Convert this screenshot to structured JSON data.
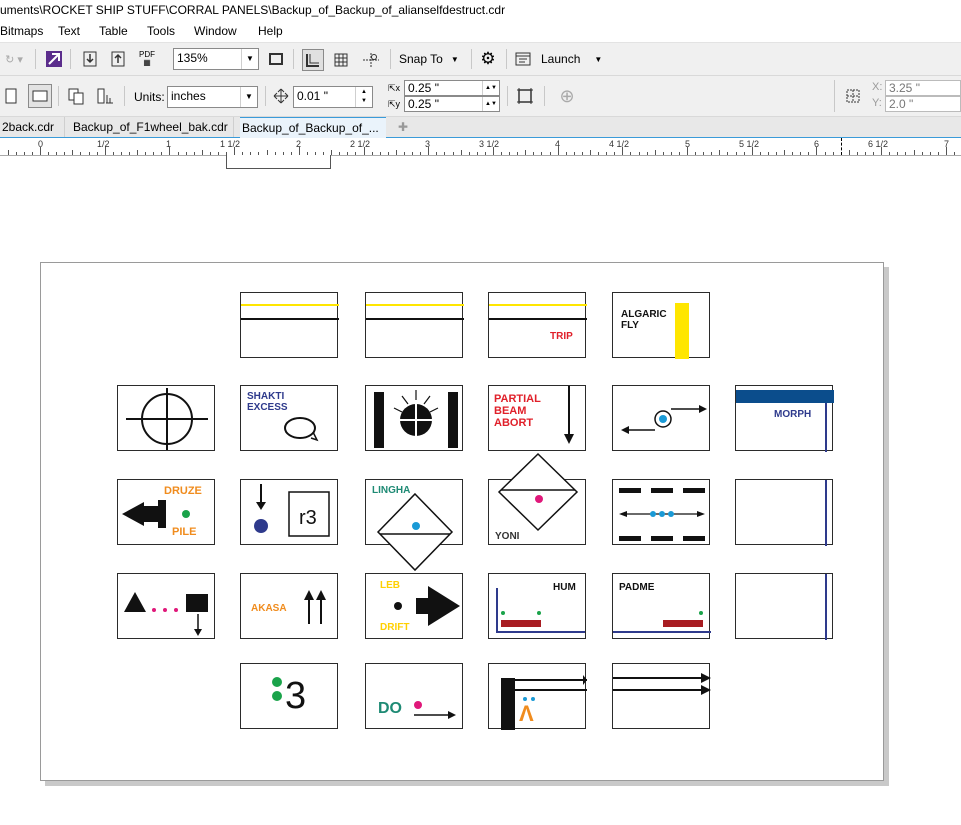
{
  "window": {
    "title": "uments\\ROCKET SHIP STUFF\\CORRAL PANELS\\Backup_of_Backup_of_alianselfdestruct.cdr"
  },
  "menu": {
    "items": [
      "Bitmaps",
      "Text",
      "Table",
      "Tools",
      "Window",
      "Help"
    ]
  },
  "toolbar": {
    "pdf_label": "PDF",
    "zoom": "135%",
    "snap_label": "Snap To",
    "launch_label": "Launch"
  },
  "property_bar": {
    "units_label": "Units:",
    "units_value": "inches",
    "nudge_value": "0.01 \"",
    "dup_x_value": "0.25 \"",
    "dup_y_value": "0.25 \"",
    "pos_x_label": "X:",
    "pos_x_value": "3.25 \"",
    "pos_y_label": "Y:",
    "pos_y_value": "2.0 \""
  },
  "tabs": [
    {
      "label": "2back.cdr",
      "active": false
    },
    {
      "label": "Backup_of_F1wheel_bak.cdr",
      "active": false
    },
    {
      "label": "Backup_of_Backup_of_...",
      "active": true
    }
  ],
  "ruler": {
    "labels": [
      "0",
      "1/2",
      "1",
      "1 1/2",
      "2",
      "2 1/2",
      "3",
      "3 1/2",
      "4",
      "4 1/2",
      "5",
      "5 1/2",
      "6",
      "6 1/2",
      "7"
    ]
  },
  "panels": {
    "trip": "TRIP",
    "algaric": "ALGARIC\nFLY",
    "shakti": "SHAKTI\nEXCESS",
    "partial": "PARTIAL\nBEAM\nABORT",
    "morph": "MORPH",
    "druze": "DRUZE",
    "pile": "PILE",
    "r3": "r3",
    "lingha": "LINGHA",
    "yoni": "YONI",
    "akasa": "AKASA",
    "leb": "LEB",
    "drift": "DRIFT",
    "hum": "HUM",
    "padme": "PADME",
    "three": "3",
    "do": "DO",
    "caret": "Λ"
  },
  "colors": {
    "yellow": "#ffe600",
    "red": "#e0202a",
    "navy": "#2e3a8c",
    "orange": "#f08c1e",
    "green": "#1aa34a",
    "teal": "#1e8a74",
    "magenta": "#e0187a",
    "cyan": "#1a9ad6",
    "darkblue": "#0b4d8c",
    "maroon": "#a81d22"
  }
}
